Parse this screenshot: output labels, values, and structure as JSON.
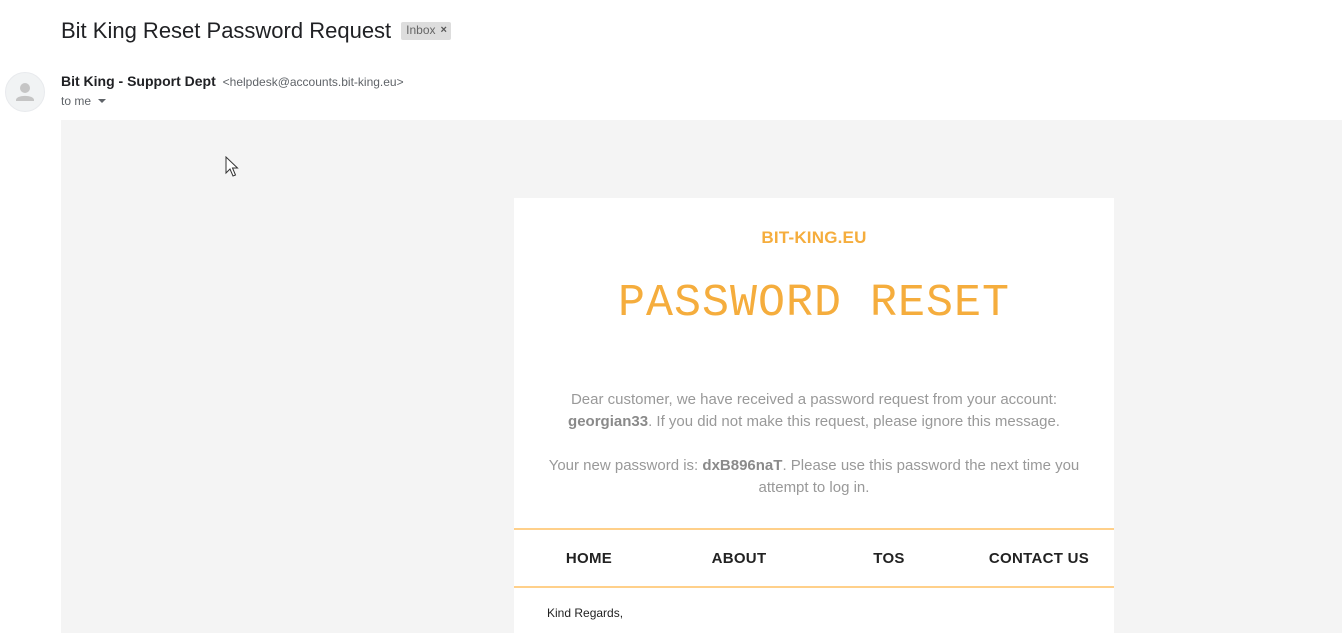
{
  "email": {
    "subject": "Bit King Reset Password Request",
    "label_chip": "Inbox",
    "label_close": "×",
    "sender_name": "Bit King - Support Dept",
    "sender_email": "<helpdesk@accounts.bit-king.eu>",
    "to_text": "to me"
  },
  "body": {
    "brand": "BIT-KING.EU",
    "headline": "PASSWORD RESET",
    "para1_pre": "Dear customer, we have received a password request from your account: ",
    "username": "georgian33",
    "para1_post": ". If you did not make this request, please ignore this message.",
    "para2_pre": "Your new password is: ",
    "password": "dxB896naT",
    "para2_post": ". Please use this password the next time you attempt to log in.",
    "nav": [
      {
        "label": "HOME"
      },
      {
        "label": "ABOUT"
      },
      {
        "label": "TOS"
      },
      {
        "label": "CONTACT US"
      }
    ],
    "regards": "Kind Regards,"
  },
  "colors": {
    "accent": "#f5ad3d",
    "nav_border": "#ffd08a",
    "body_bg": "#f4f4f4"
  },
  "icons": [
    "avatar-icon",
    "close-icon",
    "chevron-down-icon",
    "mouse-cursor-icon"
  ]
}
